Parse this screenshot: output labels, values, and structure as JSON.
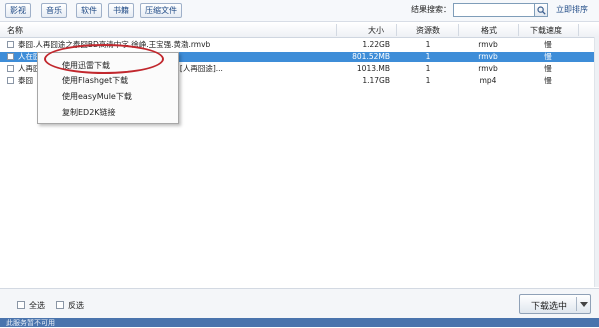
{
  "toolbar": {
    "tags": [
      "影视",
      "音乐",
      "软件",
      "书籍",
      "压缩文件"
    ],
    "search_label": "结果搜索：",
    "search_value": "",
    "sort_link": "立即排序"
  },
  "columns": {
    "name": "名称",
    "size": "大小",
    "resources": "资源数",
    "format": "格式",
    "speed": "下载速度"
  },
  "rows": [
    {
      "name": "泰囧.人再囧途之泰囧BD高清中字.徐峥.王宝强.黄渤.rmvb",
      "size": "1.22GB",
      "resources": "1",
      "format": "rmvb",
      "speed": "慢",
      "selected": false
    },
    {
      "name": "人在囧途之泰囧",
      "size": "801.52MB",
      "resources": "1",
      "format": "rmvb",
      "speed": "慢",
      "selected": true
    },
    {
      "name": "人再囧途之泰囧.国语中英双字.徐峥.王宝强.黄渤.[人再囧途]...",
      "size": "1013.MB",
      "resources": "1",
      "format": "rmvb",
      "speed": "慢",
      "selected": false
    },
    {
      "name": "泰囧",
      "size": "1.17GB",
      "resources": "1",
      "format": "mp4",
      "speed": "慢",
      "selected": false
    }
  ],
  "context_menu": {
    "items": [
      "使用迅雷下载",
      "使用Flashget下载",
      "使用easyMule下载",
      "复制ED2K链接"
    ]
  },
  "footer": {
    "select_all": "全选",
    "invert": "反选",
    "download_button": "下载选中"
  },
  "status_bar": "此服务暂不可用"
}
